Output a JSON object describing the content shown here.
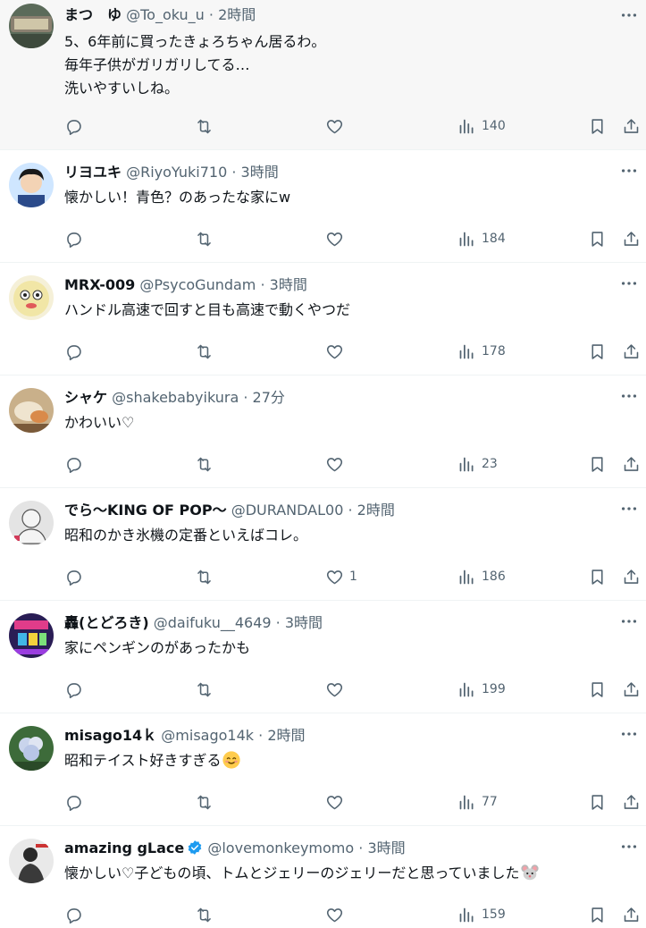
{
  "tweets": [
    {
      "name": "まつ　ゆ",
      "handle": "@To_oku_u",
      "sep": "·",
      "time": "2時間",
      "lines": [
        "5、6年前に買ったきょろちゃん居るわ。",
        "毎年子供がガリガリしてる…",
        "洗いやすいしね。"
      ],
      "likes": "",
      "views": "140",
      "avatar_color": "#5b6b5a"
    },
    {
      "name": "リヨユキ",
      "handle": "@RiyoYuki710",
      "sep": "·",
      "time": "3時間",
      "lines": [
        "懐かしい！青色？のあったな家にw"
      ],
      "likes": "",
      "views": "184",
      "avatar_color": "#2b4a8a"
    },
    {
      "name": "MRX-009",
      "handle": "@PsycoGundam",
      "sep": "·",
      "time": "3時間",
      "lines": [
        "ハンドル高速で回すと目も高速で動くやつだ"
      ],
      "likes": "",
      "views": "178",
      "avatar_color": "#e8dfa8"
    },
    {
      "name": "シャケ",
      "handle": "@shakebabyikura",
      "sep": "·",
      "time": "27分",
      "lines": [
        "かわいい♡"
      ],
      "likes": "",
      "views": "23",
      "avatar_color": "#b9a07c"
    },
    {
      "name": "でら〜KING OF POP〜",
      "handle": "@DURANDAL00",
      "sep": "·",
      "time": "2時間",
      "lines": [
        "昭和のかき氷機の定番といえばコレ。"
      ],
      "likes": "1",
      "views": "186",
      "avatar_color": "#d9d9d9"
    },
    {
      "name": "轟(とどろき)",
      "handle": "@daifuku__4649",
      "sep": "·",
      "time": "3時間",
      "lines": [
        "家にペンギンのがあったかも"
      ],
      "likes": "",
      "views": "199",
      "avatar_color": "#3a2a6a"
    },
    {
      "name": "misago14ｋ",
      "handle": "@misago14k",
      "sep": "·",
      "time": "2時間",
      "lines": [
        "昭和テイスト好きすぎる"
      ],
      "likes": "",
      "views": "77",
      "avatar_color": "#3d6b3a"
    },
    {
      "name": "amazing gLace",
      "handle": "@lovemonkeymomo",
      "sep": "·",
      "time": "3時間",
      "lines": [
        "懐かしい♡子どもの頃、トムとジェリーのジェリーだと思っていました"
      ],
      "likes": "",
      "views": "159",
      "avatar_color": "#6a6a6a",
      "verified": true
    }
  ],
  "icons": {
    "reply": "reply-icon",
    "retweet": "retweet-icon",
    "like": "heart-icon",
    "views": "views-icon",
    "bookmark": "bookmark-icon",
    "share": "share-icon",
    "more": "more-icon"
  },
  "colors": {
    "muted": "#536471",
    "verified": "#1d9bf0",
    "divider": "#eff3f4"
  }
}
